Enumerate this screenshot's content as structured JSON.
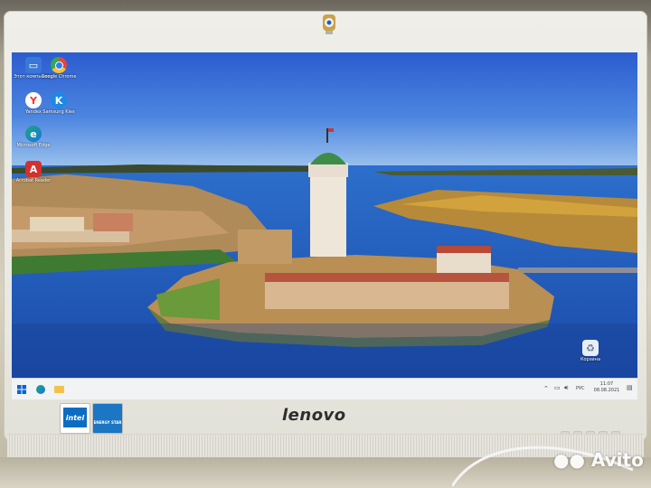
{
  "monitor": {
    "brand": "lenovo",
    "stickers": [
      "intel",
      "ENERGY STAR"
    ]
  },
  "desktop": {
    "icons": [
      {
        "name": "Этот компьютер",
        "icon": "computer-icon",
        "color": "#3a78d8"
      },
      {
        "name": "Google Chrome",
        "icon": "chrome-icon",
        "color": "#e8453c"
      },
      {
        "name": "Yandex",
        "icon": "yandex-icon",
        "color": "#ff3333"
      },
      {
        "name": "Samsung Kies",
        "icon": "kies-icon",
        "color": "#1e88e5"
      },
      {
        "name": "Microsoft Edge",
        "icon": "edge-icon",
        "color": "#1fa67a"
      },
      {
        "name": "Acrobat Reader",
        "icon": "acrobat-icon",
        "color": "#d3302f"
      },
      {
        "name": "Корзина",
        "icon": "recycle-bin-icon",
        "color": "#e8eef5"
      }
    ]
  },
  "taskbar": {
    "tray_time": "11:07",
    "tray_date": "08.08.2021",
    "language": "РУС"
  },
  "watermark": "Avito"
}
